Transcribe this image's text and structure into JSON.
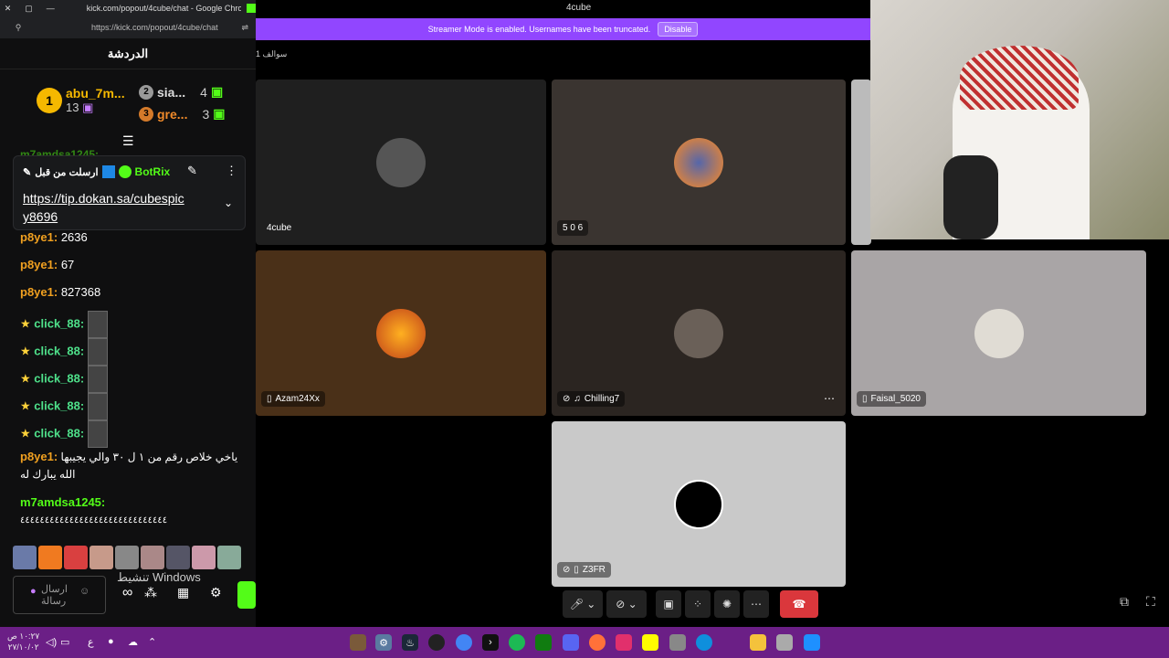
{
  "window": {
    "chrome_title": "kick.com/popout/4cube/chat - Google Chro...",
    "url": "https://kick.com/popout/4cube/chat",
    "app_title": "4cube"
  },
  "chat": {
    "title": "الدردشة",
    "leaderboard": [
      {
        "rank": "1",
        "name": "abu_7m...",
        "count": "13"
      },
      {
        "rank": "2",
        "name": "sia...",
        "count": "4"
      },
      {
        "rank": "3",
        "name": "gre...",
        "count": "3"
      }
    ],
    "top_hidden_user": "m7amdsa1245:",
    "pinned": {
      "header": "ارسلت من قبل",
      "bot": "BotRix",
      "link": "https://tip.dokan.sa/cubespic",
      "link2": "y8696"
    },
    "messages": [
      {
        "user": "p8ye1:",
        "text": "2636"
      },
      {
        "user": "p8ye1:",
        "text": "67"
      },
      {
        "user": "p8ye1:",
        "text": "827368"
      },
      {
        "user": "click_88:",
        "text": ""
      },
      {
        "user": "click_88:",
        "text": ""
      },
      {
        "user": "click_88:",
        "text": ""
      },
      {
        "user": "click_88:",
        "text": ""
      },
      {
        "user": "click_88:",
        "text": ""
      }
    ],
    "long_msg_user": "p8ye1:",
    "long_msg_line1": "ياخي خلاص رقم من ١ ل ٣٠ والي يجيبها",
    "long_msg_line2": "الله يبارك له",
    "last_user": "m7amdsa1245:",
    "last_text": "٤٤٤٤٤٤٤٤٤٤٤٤٤٤٤٤٤٤٤٤٤٤٤٤٤٤٤٤٤٤",
    "input_placeholder": "ارسال رسالة",
    "activate_windows": "تنشيط Windows"
  },
  "call": {
    "banner": "Streamer Mode is enabled. Usernames have been truncated.",
    "disable": "Disable",
    "room_label": "سوالف",
    "room_count": "1",
    "tiles": [
      {
        "name": "4cube",
        "bg": "#1f1f1f"
      },
      {
        "name": "5 0 6",
        "bg": "#3a3430"
      },
      {
        "name": "Azam24Xx",
        "bg": "#4a3018"
      },
      {
        "name": "Chilling7",
        "bg": "#2b2521"
      },
      {
        "name": "Faisal_5020",
        "bg": "#a9a5a6"
      },
      {
        "name": "Z3FR",
        "bg": "#c9c9c9"
      }
    ]
  },
  "taskbar": {
    "time": "١٠:٢٧ ص",
    "date": "٢٧/١٠/٠٢",
    "lang": "ع"
  }
}
